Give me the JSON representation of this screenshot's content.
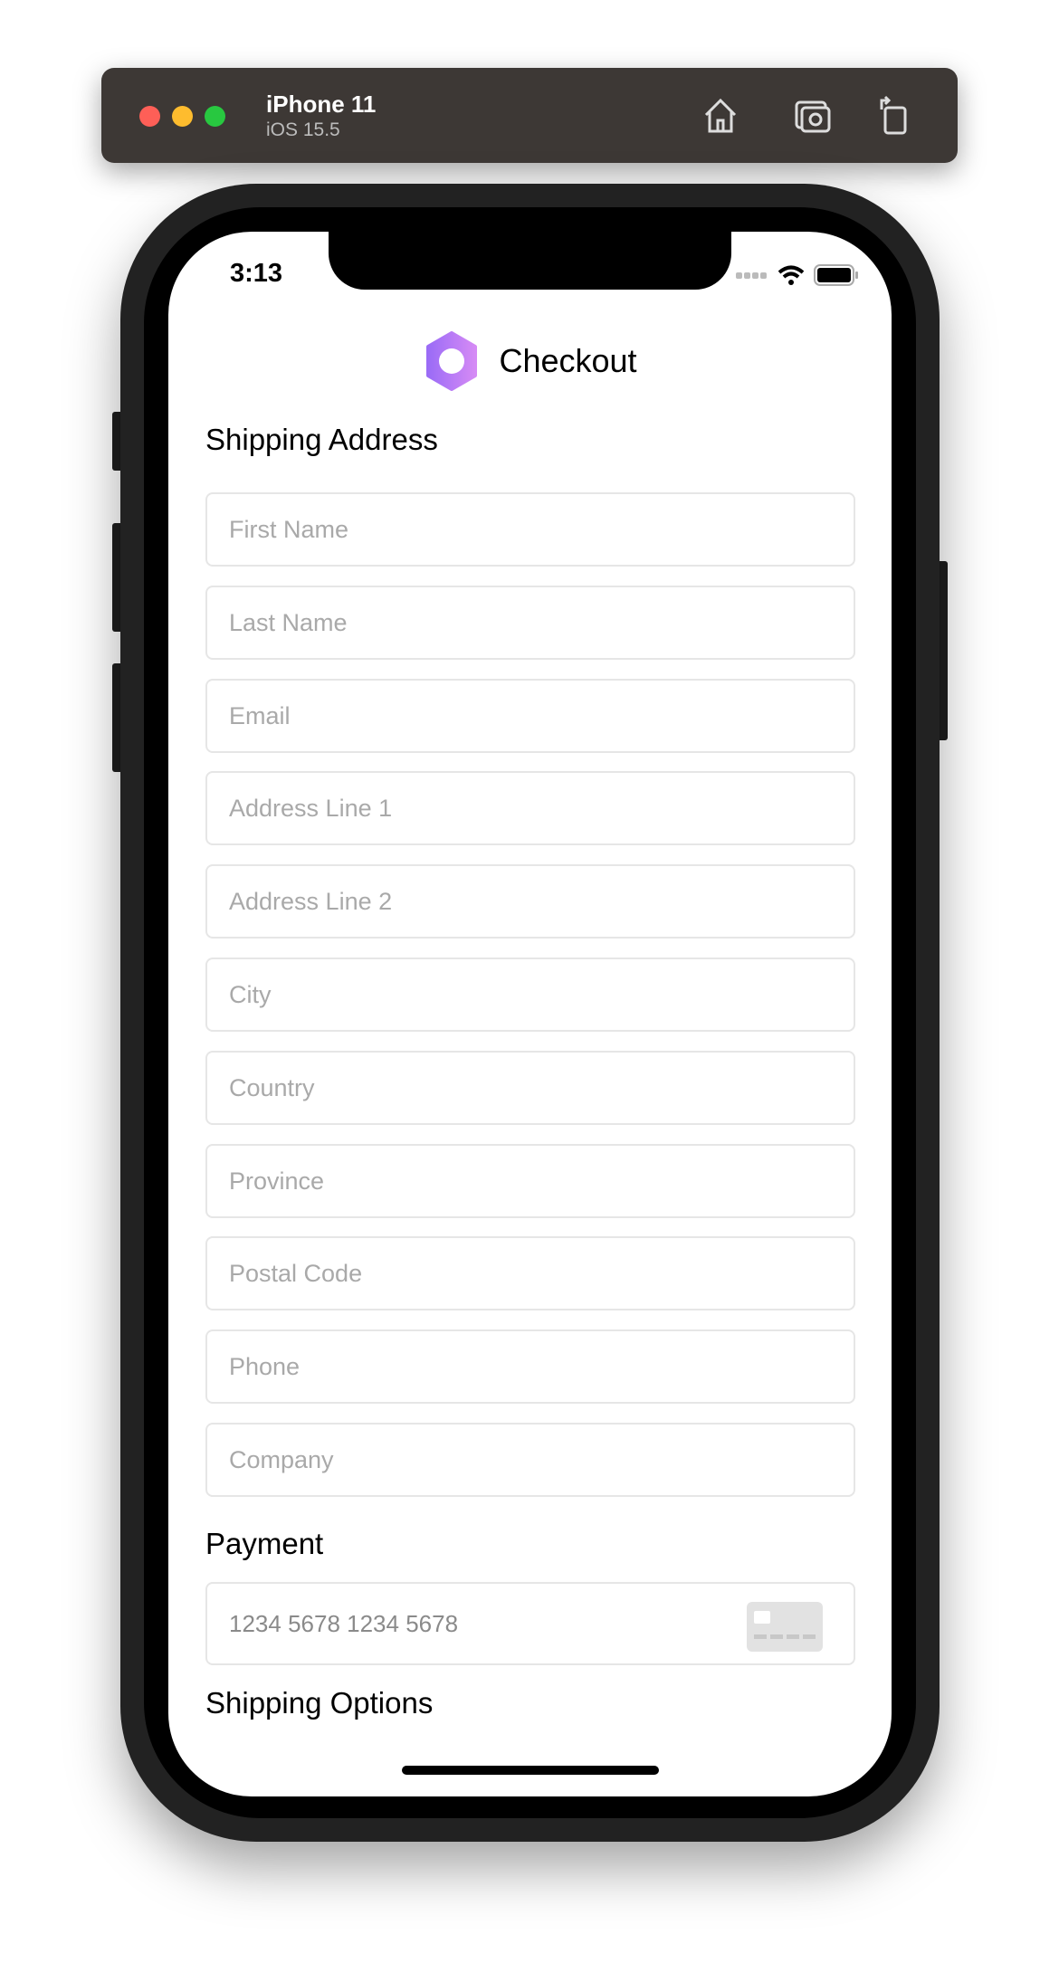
{
  "simulator": {
    "device": "iPhone 11",
    "os": "iOS 15.5",
    "window_controls": [
      "close",
      "minimize",
      "zoom"
    ],
    "actions": [
      "home-icon",
      "screenshot-icon",
      "rotate-icon"
    ]
  },
  "status_bar": {
    "time": "3:13"
  },
  "header": {
    "title": "Checkout",
    "logo": "hexagon-logo",
    "logo_colors": [
      "#9b6cf6",
      "#d58af5"
    ]
  },
  "shipping": {
    "title": "Shipping Address",
    "fields": [
      {
        "placeholder": "First Name"
      },
      {
        "placeholder": "Last Name"
      },
      {
        "placeholder": "Email"
      },
      {
        "placeholder": "Address Line 1"
      },
      {
        "placeholder": "Address Line 2"
      },
      {
        "placeholder": "City"
      },
      {
        "placeholder": "Country"
      },
      {
        "placeholder": "Province"
      },
      {
        "placeholder": "Postal Code"
      },
      {
        "placeholder": "Phone"
      },
      {
        "placeholder": "Company"
      }
    ]
  },
  "payment": {
    "title": "Payment",
    "card_placeholder": "1234 5678 1234 5678",
    "icon": "credit-card-icon"
  },
  "shipping_options": {
    "title": "Shipping Options"
  }
}
